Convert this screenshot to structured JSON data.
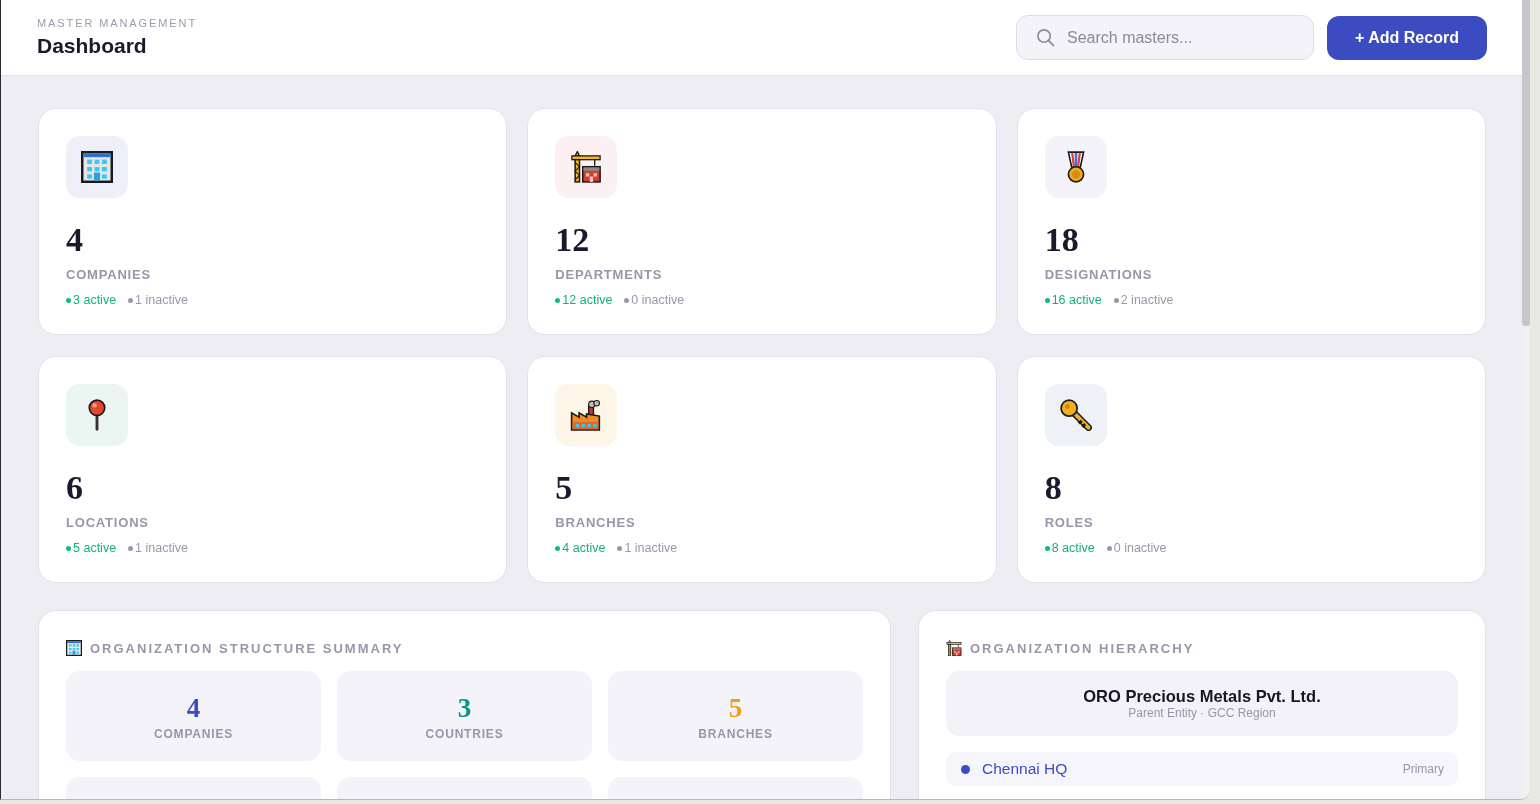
{
  "header": {
    "eyebrow": "MASTER MANAGEMENT",
    "title": "Dashboard",
    "search": {
      "placeholder": "Search masters..."
    },
    "add_button": "+ Add Record"
  },
  "stat_cards": [
    {
      "value": "4",
      "label": "COMPANIES",
      "active": "3 active",
      "inactive": "1 inactive"
    },
    {
      "value": "12",
      "label": "DEPARTMENTS",
      "active": "12 active",
      "inactive": "0 inactive"
    },
    {
      "value": "18",
      "label": "DESIGNATIONS",
      "active": "16 active",
      "inactive": "2 inactive"
    },
    {
      "value": "6",
      "label": "LOCATIONS",
      "active": "5 active",
      "inactive": "1 inactive"
    },
    {
      "value": "5",
      "label": "BRANCHES",
      "active": "4 active",
      "inactive": "1 inactive"
    },
    {
      "value": "8",
      "label": "ROLES",
      "active": "8 active",
      "inactive": "0 inactive"
    }
  ],
  "structure_summary": {
    "title": "ORGANIZATION STRUCTURE SUMMARY",
    "tiles": [
      {
        "value": "4",
        "label": "COMPANIES",
        "color": "#3b4cc0"
      },
      {
        "value": "3",
        "label": "COUNTRIES",
        "color": "#0d9488"
      },
      {
        "value": "5",
        "label": "BRANCHES",
        "color": "#f59e0b"
      }
    ]
  },
  "hierarchy": {
    "title": "ORGANIZATION HIERARCHY",
    "parent": {
      "name": "ORO Precious Metals Pvt. Ltd.",
      "subtitle": "Parent Entity · GCC Region"
    },
    "branches": [
      {
        "name": "Chennai HQ",
        "tag": "Primary"
      }
    ]
  }
}
